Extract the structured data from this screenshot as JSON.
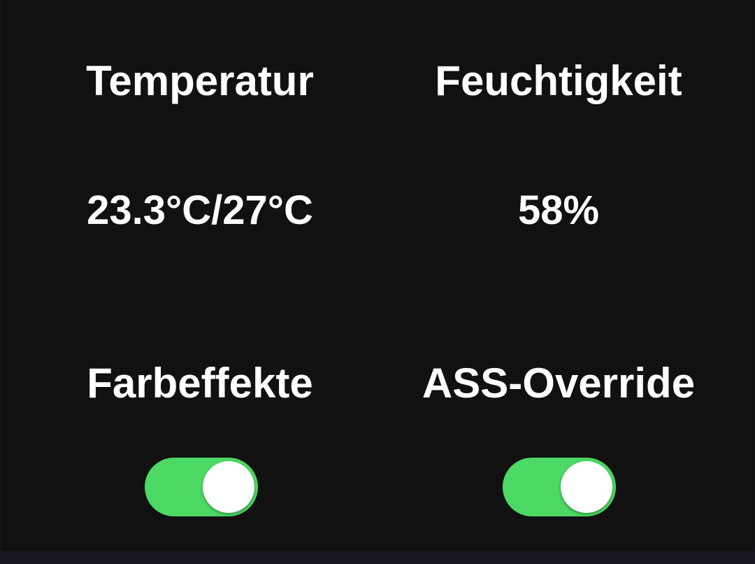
{
  "sensors": {
    "temperature": {
      "title": "Temperatur",
      "value": "23.3°C/27°C"
    },
    "humidity": {
      "title": "Feuchtigkeit",
      "value": "58%"
    }
  },
  "switches": {
    "color_effects": {
      "label": "Farbeffekte",
      "on": true
    },
    "ass_override": {
      "label": "ASS-Override",
      "on": true
    }
  },
  "colors": {
    "background": "#111111",
    "text": "#ffffff",
    "toggle_on": "#4cd964",
    "toggle_knob": "#ffffff"
  }
}
